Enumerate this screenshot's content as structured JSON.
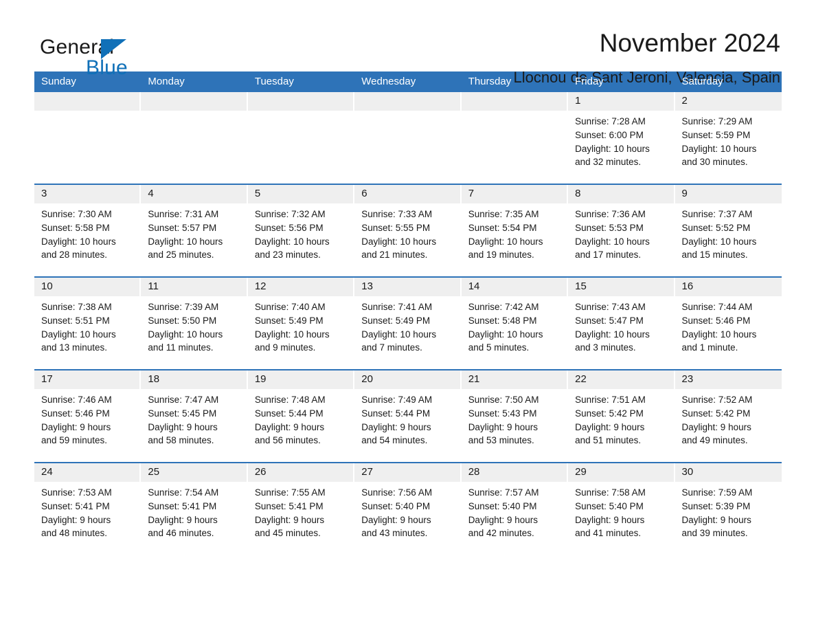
{
  "brand": {
    "name_part1": "General",
    "name_part2": "Blue",
    "accent_color": "#1070b8",
    "triangle_icon": "brand-triangle-icon"
  },
  "header": {
    "title": "November 2024",
    "location": "Llocnou de Sant Jeroni, Valencia, Spain"
  },
  "calendar": {
    "header_bg": "#2e73b8",
    "daynum_bg": "#efefef",
    "weekdays": [
      "Sunday",
      "Monday",
      "Tuesday",
      "Wednesday",
      "Thursday",
      "Friday",
      "Saturday"
    ],
    "weeks": [
      [
        {
          "day": "",
          "sunrise": "",
          "sunset": "",
          "daylight_line1": "",
          "daylight_line2": "",
          "empty": true
        },
        {
          "day": "",
          "sunrise": "",
          "sunset": "",
          "daylight_line1": "",
          "daylight_line2": "",
          "empty": true
        },
        {
          "day": "",
          "sunrise": "",
          "sunset": "",
          "daylight_line1": "",
          "daylight_line2": "",
          "empty": true
        },
        {
          "day": "",
          "sunrise": "",
          "sunset": "",
          "daylight_line1": "",
          "daylight_line2": "",
          "empty": true
        },
        {
          "day": "",
          "sunrise": "",
          "sunset": "",
          "daylight_line1": "",
          "daylight_line2": "",
          "empty": true
        },
        {
          "day": "1",
          "sunrise": "Sunrise: 7:28 AM",
          "sunset": "Sunset: 6:00 PM",
          "daylight_line1": "Daylight: 10 hours",
          "daylight_line2": "and 32 minutes.",
          "empty": false
        },
        {
          "day": "2",
          "sunrise": "Sunrise: 7:29 AM",
          "sunset": "Sunset: 5:59 PM",
          "daylight_line1": "Daylight: 10 hours",
          "daylight_line2": "and 30 minutes.",
          "empty": false
        }
      ],
      [
        {
          "day": "3",
          "sunrise": "Sunrise: 7:30 AM",
          "sunset": "Sunset: 5:58 PM",
          "daylight_line1": "Daylight: 10 hours",
          "daylight_line2": "and 28 minutes.",
          "empty": false
        },
        {
          "day": "4",
          "sunrise": "Sunrise: 7:31 AM",
          "sunset": "Sunset: 5:57 PM",
          "daylight_line1": "Daylight: 10 hours",
          "daylight_line2": "and 25 minutes.",
          "empty": false
        },
        {
          "day": "5",
          "sunrise": "Sunrise: 7:32 AM",
          "sunset": "Sunset: 5:56 PM",
          "daylight_line1": "Daylight: 10 hours",
          "daylight_line2": "and 23 minutes.",
          "empty": false
        },
        {
          "day": "6",
          "sunrise": "Sunrise: 7:33 AM",
          "sunset": "Sunset: 5:55 PM",
          "daylight_line1": "Daylight: 10 hours",
          "daylight_line2": "and 21 minutes.",
          "empty": false
        },
        {
          "day": "7",
          "sunrise": "Sunrise: 7:35 AM",
          "sunset": "Sunset: 5:54 PM",
          "daylight_line1": "Daylight: 10 hours",
          "daylight_line2": "and 19 minutes.",
          "empty": false
        },
        {
          "day": "8",
          "sunrise": "Sunrise: 7:36 AM",
          "sunset": "Sunset: 5:53 PM",
          "daylight_line1": "Daylight: 10 hours",
          "daylight_line2": "and 17 minutes.",
          "empty": false
        },
        {
          "day": "9",
          "sunrise": "Sunrise: 7:37 AM",
          "sunset": "Sunset: 5:52 PM",
          "daylight_line1": "Daylight: 10 hours",
          "daylight_line2": "and 15 minutes.",
          "empty": false
        }
      ],
      [
        {
          "day": "10",
          "sunrise": "Sunrise: 7:38 AM",
          "sunset": "Sunset: 5:51 PM",
          "daylight_line1": "Daylight: 10 hours",
          "daylight_line2": "and 13 minutes.",
          "empty": false
        },
        {
          "day": "11",
          "sunrise": "Sunrise: 7:39 AM",
          "sunset": "Sunset: 5:50 PM",
          "daylight_line1": "Daylight: 10 hours",
          "daylight_line2": "and 11 minutes.",
          "empty": false
        },
        {
          "day": "12",
          "sunrise": "Sunrise: 7:40 AM",
          "sunset": "Sunset: 5:49 PM",
          "daylight_line1": "Daylight: 10 hours",
          "daylight_line2": "and 9 minutes.",
          "empty": false
        },
        {
          "day": "13",
          "sunrise": "Sunrise: 7:41 AM",
          "sunset": "Sunset: 5:49 PM",
          "daylight_line1": "Daylight: 10 hours",
          "daylight_line2": "and 7 minutes.",
          "empty": false
        },
        {
          "day": "14",
          "sunrise": "Sunrise: 7:42 AM",
          "sunset": "Sunset: 5:48 PM",
          "daylight_line1": "Daylight: 10 hours",
          "daylight_line2": "and 5 minutes.",
          "empty": false
        },
        {
          "day": "15",
          "sunrise": "Sunrise: 7:43 AM",
          "sunset": "Sunset: 5:47 PM",
          "daylight_line1": "Daylight: 10 hours",
          "daylight_line2": "and 3 minutes.",
          "empty": false
        },
        {
          "day": "16",
          "sunrise": "Sunrise: 7:44 AM",
          "sunset": "Sunset: 5:46 PM",
          "daylight_line1": "Daylight: 10 hours",
          "daylight_line2": "and 1 minute.",
          "empty": false
        }
      ],
      [
        {
          "day": "17",
          "sunrise": "Sunrise: 7:46 AM",
          "sunset": "Sunset: 5:46 PM",
          "daylight_line1": "Daylight: 9 hours",
          "daylight_line2": "and 59 minutes.",
          "empty": false
        },
        {
          "day": "18",
          "sunrise": "Sunrise: 7:47 AM",
          "sunset": "Sunset: 5:45 PM",
          "daylight_line1": "Daylight: 9 hours",
          "daylight_line2": "and 58 minutes.",
          "empty": false
        },
        {
          "day": "19",
          "sunrise": "Sunrise: 7:48 AM",
          "sunset": "Sunset: 5:44 PM",
          "daylight_line1": "Daylight: 9 hours",
          "daylight_line2": "and 56 minutes.",
          "empty": false
        },
        {
          "day": "20",
          "sunrise": "Sunrise: 7:49 AM",
          "sunset": "Sunset: 5:44 PM",
          "daylight_line1": "Daylight: 9 hours",
          "daylight_line2": "and 54 minutes.",
          "empty": false
        },
        {
          "day": "21",
          "sunrise": "Sunrise: 7:50 AM",
          "sunset": "Sunset: 5:43 PM",
          "daylight_line1": "Daylight: 9 hours",
          "daylight_line2": "and 53 minutes.",
          "empty": false
        },
        {
          "day": "22",
          "sunrise": "Sunrise: 7:51 AM",
          "sunset": "Sunset: 5:42 PM",
          "daylight_line1": "Daylight: 9 hours",
          "daylight_line2": "and 51 minutes.",
          "empty": false
        },
        {
          "day": "23",
          "sunrise": "Sunrise: 7:52 AM",
          "sunset": "Sunset: 5:42 PM",
          "daylight_line1": "Daylight: 9 hours",
          "daylight_line2": "and 49 minutes.",
          "empty": false
        }
      ],
      [
        {
          "day": "24",
          "sunrise": "Sunrise: 7:53 AM",
          "sunset": "Sunset: 5:41 PM",
          "daylight_line1": "Daylight: 9 hours",
          "daylight_line2": "and 48 minutes.",
          "empty": false
        },
        {
          "day": "25",
          "sunrise": "Sunrise: 7:54 AM",
          "sunset": "Sunset: 5:41 PM",
          "daylight_line1": "Daylight: 9 hours",
          "daylight_line2": "and 46 minutes.",
          "empty": false
        },
        {
          "day": "26",
          "sunrise": "Sunrise: 7:55 AM",
          "sunset": "Sunset: 5:41 PM",
          "daylight_line1": "Daylight: 9 hours",
          "daylight_line2": "and 45 minutes.",
          "empty": false
        },
        {
          "day": "27",
          "sunrise": "Sunrise: 7:56 AM",
          "sunset": "Sunset: 5:40 PM",
          "daylight_line1": "Daylight: 9 hours",
          "daylight_line2": "and 43 minutes.",
          "empty": false
        },
        {
          "day": "28",
          "sunrise": "Sunrise: 7:57 AM",
          "sunset": "Sunset: 5:40 PM",
          "daylight_line1": "Daylight: 9 hours",
          "daylight_line2": "and 42 minutes.",
          "empty": false
        },
        {
          "day": "29",
          "sunrise": "Sunrise: 7:58 AM",
          "sunset": "Sunset: 5:40 PM",
          "daylight_line1": "Daylight: 9 hours",
          "daylight_line2": "and 41 minutes.",
          "empty": false
        },
        {
          "day": "30",
          "sunrise": "Sunrise: 7:59 AM",
          "sunset": "Sunset: 5:39 PM",
          "daylight_line1": "Daylight: 9 hours",
          "daylight_line2": "and 39 minutes.",
          "empty": false
        }
      ]
    ]
  }
}
